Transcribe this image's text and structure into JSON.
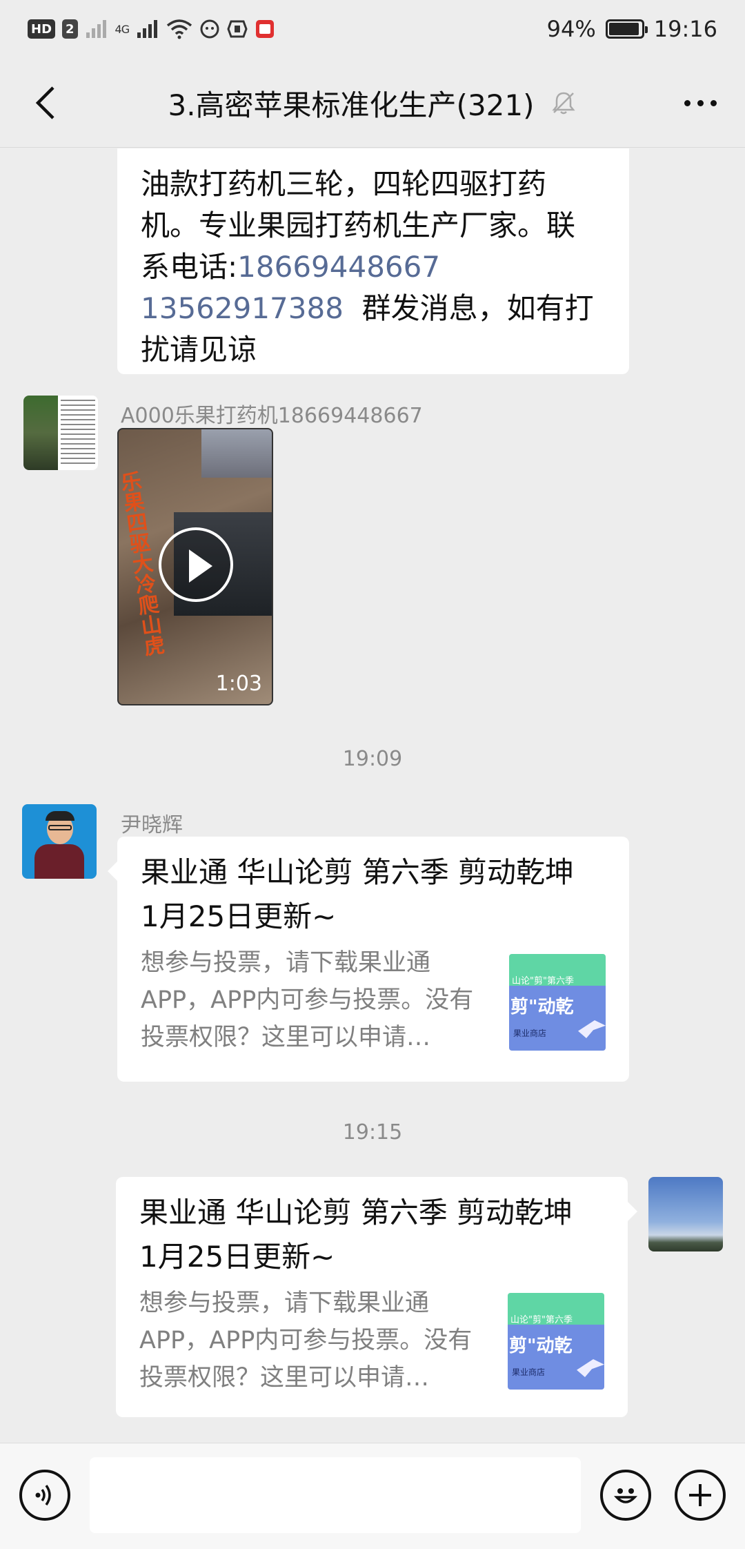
{
  "status_bar": {
    "hd_label": "HD",
    "sim_label": "2",
    "network_label": "4G",
    "battery_percent": "94%",
    "battery_level": 0.94,
    "time": "19:16"
  },
  "header": {
    "title": "3.高密苹果标准化生产(321)"
  },
  "messages": {
    "top_partial": {
      "line1": "油款打药机三轮，四轮四驱打药",
      "line2": "机。专业果园打药机生产厂家。联",
      "line3_prefix": "系电话:",
      "phone1": "18669448667",
      "phone2": "13562917388",
      "line4_suffix": "  群发消息，如有打",
      "line5": "扰请见谅"
    },
    "video_msg": {
      "sender": "A000乐果打药机18669448667",
      "duration": "1:03",
      "caption": "乐果四驱大冷爬山虎"
    },
    "timestamp1": "19:09",
    "link_msg_1": {
      "sender": "尹晓辉",
      "title": "果业通 华山论剪 第六季 剪动乾坤 1月25日更新~",
      "desc": "想参与投票，请下载果业通APP，APP内可参与投票。没有投票权限？这里可以申请…"
    },
    "timestamp2": "19:15",
    "link_msg_2": {
      "title": "果业通 华山论剪 第六季 剪动乾坤 1月25日更新~",
      "desc": "想参与投票，请下载果业通APP，APP内可参与投票。没有投票权限？这里可以申请…"
    },
    "thumb_text": {
      "top": "山论\"剪\"第六季",
      "main": "剪\"动乾",
      "sub": "果业商店"
    }
  },
  "colors": {
    "background": "#ededed",
    "bubble": "#ffffff",
    "link": "#576b95",
    "thumb_top": "#5fd6a5",
    "thumb_bottom": "#6f8de2"
  }
}
